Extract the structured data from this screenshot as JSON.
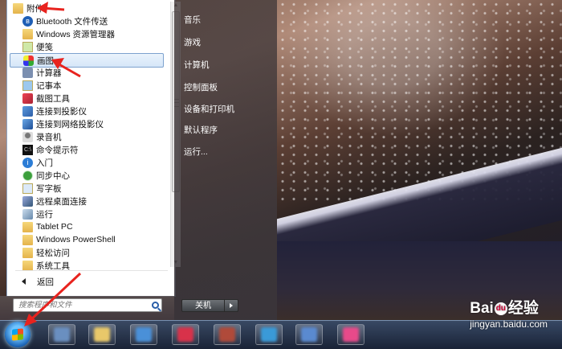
{
  "start_menu": {
    "top_folder": "附件",
    "items": [
      {
        "label": "Bluetooth 文件传送",
        "icon": "bluetooth-icon"
      },
      {
        "label": "Windows 资源管理器",
        "icon": "explorer-folder-icon"
      },
      {
        "label": "便笺",
        "icon": "sticky-notes-icon"
      },
      {
        "label": "画图",
        "icon": "paint-icon",
        "selected": true
      },
      {
        "label": "计算器",
        "icon": "calculator-icon"
      },
      {
        "label": "记事本",
        "icon": "notepad-icon"
      },
      {
        "label": "截图工具",
        "icon": "snipping-tool-icon"
      },
      {
        "label": "连接到投影仪",
        "icon": "projector-icon"
      },
      {
        "label": "连接到网络投影仪",
        "icon": "network-projector-icon"
      },
      {
        "label": "录音机",
        "icon": "microphone-icon"
      },
      {
        "label": "命令提示符",
        "icon": "command-prompt-icon"
      },
      {
        "label": "入门",
        "icon": "getting-started-icon"
      },
      {
        "label": "同步中心",
        "icon": "sync-center-icon"
      },
      {
        "label": "写字板",
        "icon": "wordpad-icon"
      },
      {
        "label": "远程桌面连接",
        "icon": "remote-desktop-icon"
      },
      {
        "label": "运行",
        "icon": "run-icon"
      },
      {
        "label": "Tablet PC",
        "icon": "folder-icon"
      },
      {
        "label": "Windows PowerShell",
        "icon": "folder-icon"
      },
      {
        "label": "轻松访问",
        "icon": "folder-icon"
      },
      {
        "label": "系统工具",
        "icon": "folder-icon"
      }
    ],
    "back_label": "返回",
    "search_placeholder": "搜索程序和文件",
    "right_items": [
      "音乐",
      "游戏",
      "计算机",
      "控制面板",
      "设备和打印机",
      "默认程序",
      "运行..."
    ],
    "shutdown_label": "关机"
  },
  "watermark": {
    "brand": "Bai",
    "brand_tail": "经验",
    "url": "jingyan.baidu.com"
  },
  "colors": {
    "annotation_arrow": "#e8231e",
    "selection_border": "#7da2ce"
  }
}
